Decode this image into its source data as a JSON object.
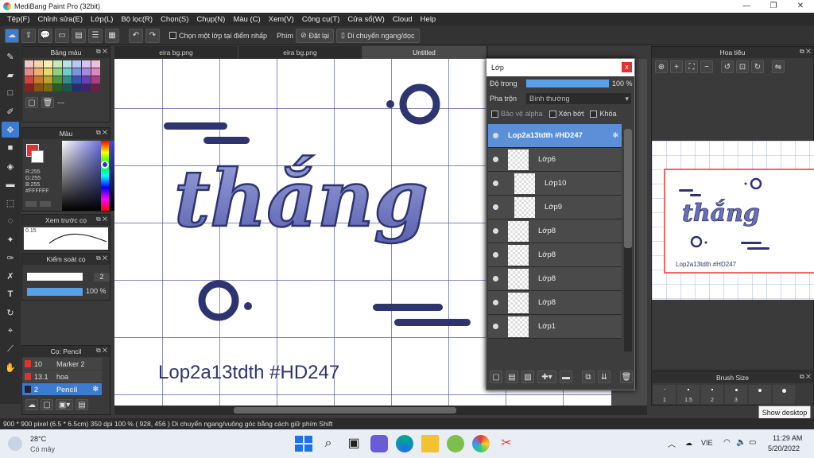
{
  "window": {
    "title": "MediBang Paint Pro (32bit)",
    "controls": [
      "—",
      "❐",
      "✕"
    ]
  },
  "menu": [
    "Tệp(F)",
    "Chỉnh sửa(E)",
    "Lớp(L)",
    "Bộ lọc(R)",
    "Chọn(S)",
    "Chụp(N)",
    "Màu (C)",
    "Xem(V)",
    "Công cụ(T)",
    "Cửa sổ(W)",
    "Cloud",
    "Help"
  ],
  "toolbar": {
    "select_layer_label": "Chọn một lớp tại điểm nhấp",
    "key_label": "Phím",
    "reset_label": "Đặt lại",
    "move_label": "Di chuyển ngang/dọc"
  },
  "tabs": [
    "eira bg.png",
    "eira bg.png",
    "Untitled"
  ],
  "palette_panel": {
    "title": "Bảng màu",
    "colors": [
      "#f2c6c6",
      "#f5d6a8",
      "#f7efb0",
      "#c9e8b5",
      "#b5e3e3",
      "#b8c8ef",
      "#d8c0ef",
      "#efc0dc",
      "#e58b8b",
      "#e9b274",
      "#e6d86a",
      "#8fd27a",
      "#6fcdcd",
      "#7a95e0",
      "#a987e0",
      "#de87bd",
      "#c44",
      "#c77a2b",
      "#b8a52f",
      "#4a9a3a",
      "#2f8f8f",
      "#3656b0",
      "#6a40b0",
      "#a8407f",
      "#8a2020",
      "#8b5313",
      "#7a6c10",
      "#2a5d20",
      "#1a5656",
      "#1f2f70",
      "#3f2370",
      "#6a1f4c"
    ],
    "extra": "---"
  },
  "color_panel": {
    "title": "Màu",
    "r": "R:255",
    "g": "G:255",
    "b": "B:255",
    "hex": "#FFFFFF"
  },
  "preview_panel": {
    "title": "Xem trước cọ",
    "value": "0.15"
  },
  "brush_control_panel": {
    "title": "Kiểm soát cọ",
    "size": "2",
    "opacity": "100 %"
  },
  "brush_list_panel": {
    "title": "Cọ: Pencil",
    "items": [
      {
        "size": "10",
        "name": "Marker 2",
        "color": "#d33"
      },
      {
        "size": "13.1",
        "name": "hoa",
        "color": "#d33"
      },
      {
        "size": "2",
        "name": "Pencil",
        "color": "#3b7bd1"
      }
    ]
  },
  "canvas": {
    "title_text": "thắng",
    "caption": "Lop2a13tdth #HD247"
  },
  "layers": {
    "title": "Lớp",
    "opacity_label": "Độ trong",
    "opacity_value": "100 %",
    "opacity_fraction": 1.0,
    "blend_label": "Pha trộn",
    "blend_value": "Bình thường",
    "protect_alpha": "Bảo vệ alpha",
    "clipping": "Xén bớt",
    "lock": "Khóa",
    "items": [
      {
        "name": "Lop2a13tdth #HD247",
        "selected": true
      },
      {
        "name": "Lớp6"
      },
      {
        "name": "Lớp10",
        "indent": true
      },
      {
        "name": "Lớp9",
        "indent": true
      },
      {
        "name": "Lớp8"
      },
      {
        "name": "Lớp8"
      },
      {
        "name": "Lớp8"
      },
      {
        "name": "Lớp8"
      },
      {
        "name": "Lớp1"
      }
    ]
  },
  "navigator": {
    "title": "Hoa tiêu",
    "caption": "Lop2a13tdth #HD247",
    "thumb_text": "thắng"
  },
  "brush_size": {
    "title": "Brush Size",
    "sizes": [
      "1",
      "1.5",
      "2",
      "3"
    ]
  },
  "tooltip": "Show desktop",
  "status": {
    "text": "900 * 900 pixel  (6.5 * 6.5cm)  350 dpi  100 %  ( 928, 456 )  Di chuyển ngang/vuông góc bằng cách giữ phím Shift"
  },
  "taskbar": {
    "temp": "28°C",
    "weather": "Có mây",
    "lang": "VIE",
    "time": "11:29 AM",
    "date": "5/20/2022"
  },
  "colors": {
    "accent": "#3b7bd1",
    "navy": "#2e3470",
    "grid": "#3a3f8f"
  }
}
